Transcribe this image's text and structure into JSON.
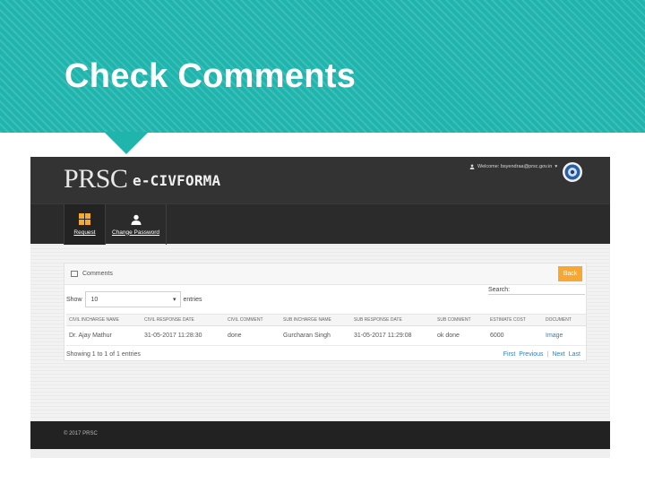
{
  "slide": {
    "title": "Check Comments"
  },
  "app": {
    "logo_main": "PRSC",
    "logo_sub": "e-CIVFORMA",
    "welcome_text": "Welcome: bsyendraa@prsc.gov.in",
    "nav": [
      {
        "label": "Request"
      },
      {
        "label": "Change Password"
      }
    ],
    "panel": {
      "title": "Comments",
      "back_label": "Back",
      "show_label": "Show",
      "entries_value": "10",
      "entries_label": "entries",
      "search_label": "Search:"
    },
    "table": {
      "columns": [
        "CIVIL INCHARGE NAME",
        "CIVIL RESPONSE DATE",
        "CIVIL COMMENT",
        "SUB INCHARGE NAME",
        "SUB RESPONSE DATE",
        "SUB COMMENT",
        "ESTIMATE COST",
        "DOCUMENT"
      ],
      "rows": [
        [
          "Dr. Ajay Mathur",
          "31-05-2017 11:28:30",
          "done",
          "Gurcharan Singh",
          "31-05-2017 11:29:08",
          "ok done",
          "6000",
          "Image"
        ]
      ]
    },
    "footer_info": "Showing 1 to 1 of 1 entries",
    "pager": {
      "first": "First",
      "previous": "Previous",
      "next": "Next",
      "last": "Last"
    },
    "copyright": "© 2017 PRSC"
  },
  "colors": {
    "slide_teal": "#1fb5ad",
    "back_button": "#f7a733",
    "link_blue": "#2e7fc2",
    "topbar": "#333333"
  },
  "icons": [
    "grid-icon",
    "user-icon",
    "emblem-icon",
    "list-icon",
    "chevron-down-icon"
  ]
}
